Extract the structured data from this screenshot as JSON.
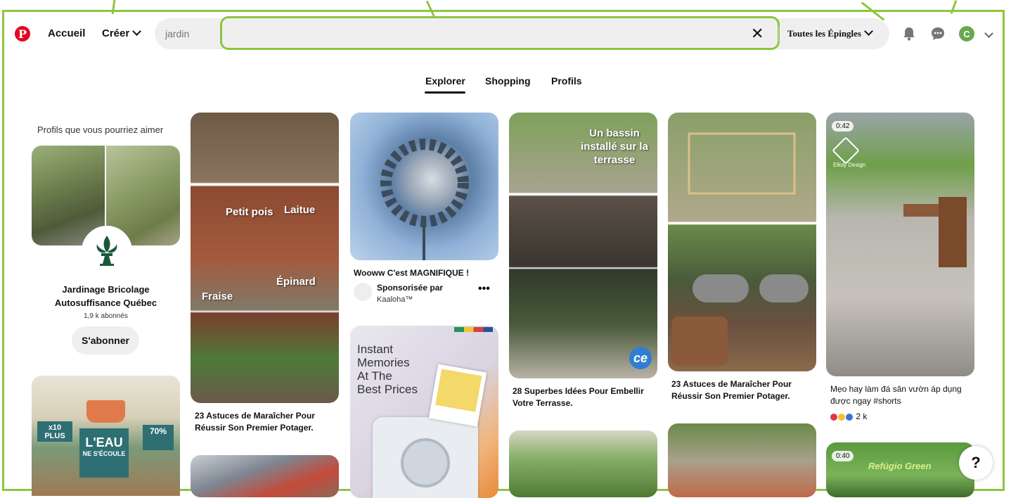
{
  "header": {
    "logo_letter": "P",
    "home_label": "Accueil",
    "create_label": "Créer",
    "search_value": "jardin",
    "filter_label": "Toutes les Épingles",
    "avatar_letter": "C"
  },
  "tabs": [
    "Explorer",
    "Shopping",
    "Profils"
  ],
  "profiles": {
    "title": "Profils que vous pourriez aimer",
    "name_line1": "Jardinage Bricolage",
    "name_line2": "Autosuffisance Québec",
    "subscribers": "1,9 k abonnés",
    "follow_label": "S'abonner"
  },
  "left_card": {
    "badge1": "x10 PLUS",
    "badge2": "70%",
    "main": "L'EAU",
    "sub": "NE S'ÉCOULE"
  },
  "pins": {
    "col1_title": "23 Astuces de Maraîcher Pour Réussir Son Premier Potager.",
    "col1_overlays": [
      "Petit pois",
      "Laitue",
      "Épinard",
      "Fraise"
    ],
    "col2_title": "Wooww C'est MAGNIFIQUE !",
    "col2_sponsor": "Sponsorisée par",
    "col2_sponsor_name": "Kaaloha™",
    "col2_ad_line1": "Instant",
    "col2_ad_line2": "Memories",
    "col2_ad_line3": "At The",
    "col2_ad_line4": "Best Prices",
    "col3_overlay": "Un bassin installé sur la terrasse",
    "col3_badge": "ce",
    "col3_title": "28 Superbes Idées Pour Embellir Votre Terrasse.",
    "col4_title": "23 Astuces de Maraîcher Pour Réussir Son Premier Potager.",
    "col5_duration": "0:42",
    "col5_brand": "Elloly Design",
    "col5_title": "Mẹo hay làm đá sân vườn áp dụng được ngay #shorts",
    "col5_reactions": "2 k",
    "col5_duration2": "0:40",
    "col5_overlay2": "Refúgio Green"
  },
  "help_label": "?",
  "colors": {
    "accent": "#8dc63f",
    "pinterest_red": "#e60023"
  }
}
